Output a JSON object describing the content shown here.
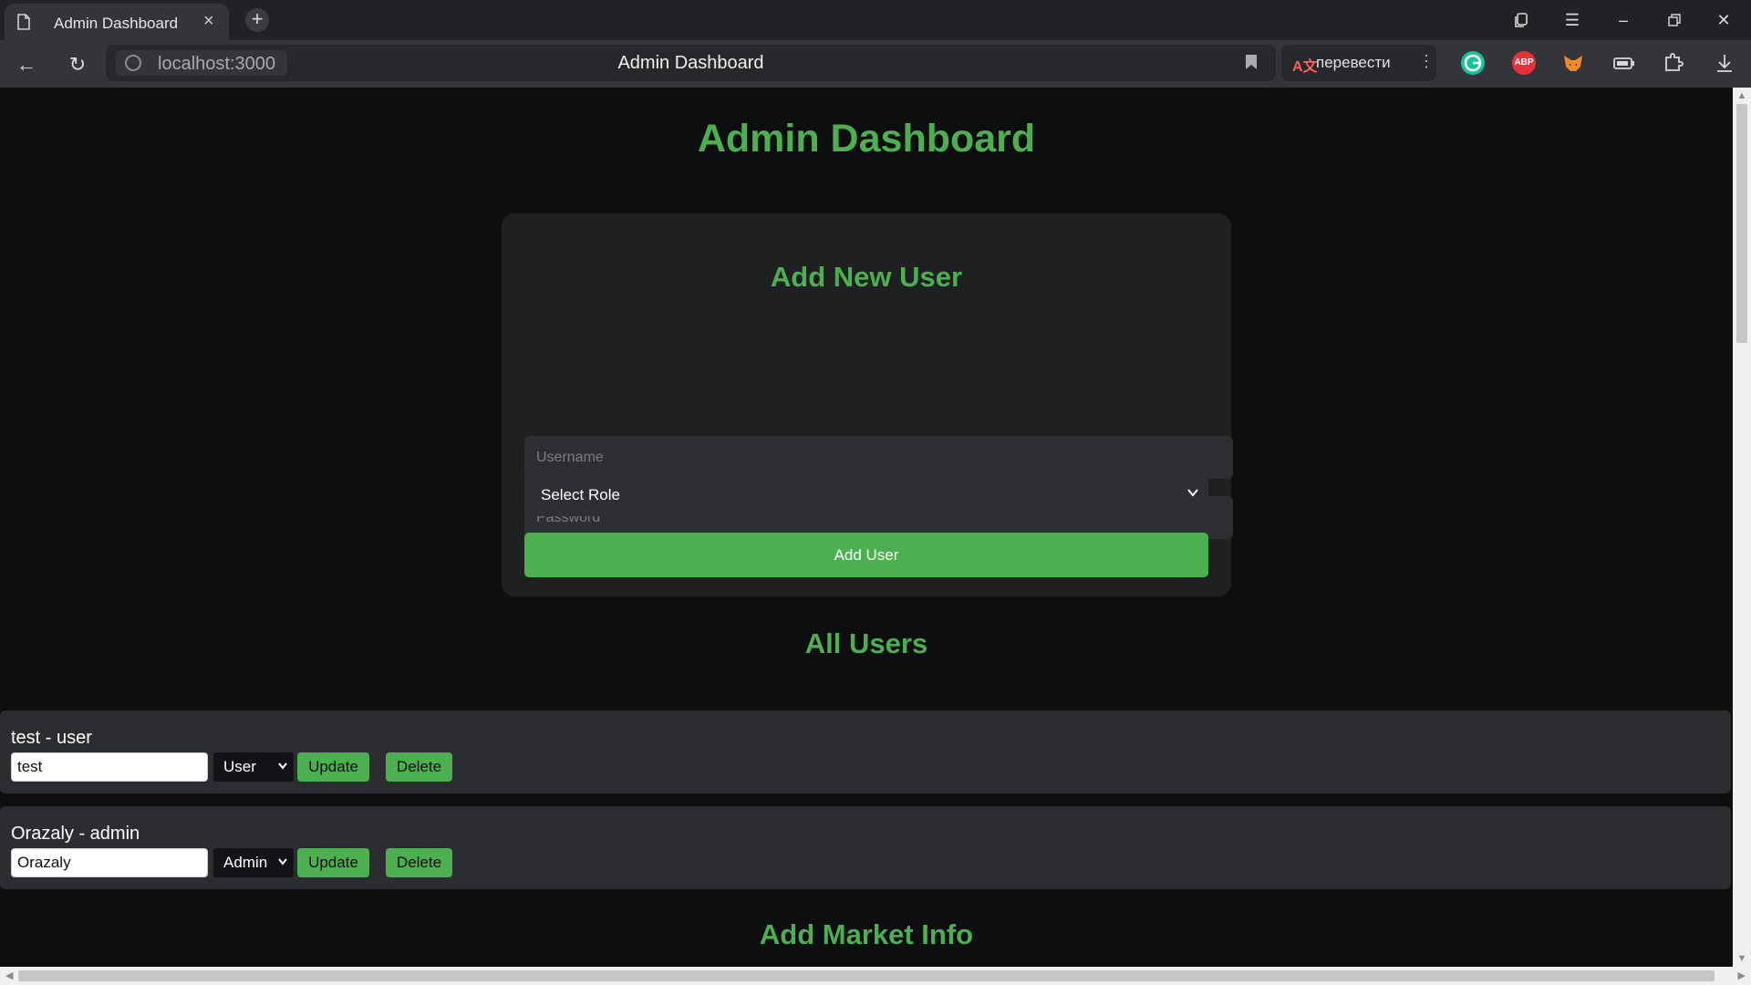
{
  "browser": {
    "tab_title": "Admin Dashboard",
    "url": "localhost:3000",
    "omnibox_title": "Admin Dashboard",
    "translate_label": "перевести",
    "extensions": [
      "grammarly-icon",
      "adblock-plus-icon",
      "metamask-icon",
      "battery-saver-icon",
      "puzzle-icon",
      "download-icon"
    ],
    "adblock_text": "ABP"
  },
  "page": {
    "title": "Admin Dashboard",
    "add_user": {
      "heading": "Add New User",
      "username_placeholder": "Username",
      "password_placeholder": "Password",
      "role_selected": "Select Role",
      "submit_label": "Add User"
    },
    "all_users_heading": "All Users",
    "users": [
      {
        "label": "test - user",
        "name_value": "test",
        "role": "User",
        "update_label": "Update",
        "delete_label": "Delete"
      },
      {
        "label": "Orazaly - admin",
        "name_value": "Orazaly",
        "role": "Admin",
        "update_label": "Update",
        "delete_label": "Delete"
      }
    ],
    "market_heading": "Add Market Info"
  },
  "colors": {
    "accent": "#4caf50",
    "page_bg": "#0d0e10",
    "card_bg": "#1f2022",
    "row_bg": "#2c2d30"
  }
}
